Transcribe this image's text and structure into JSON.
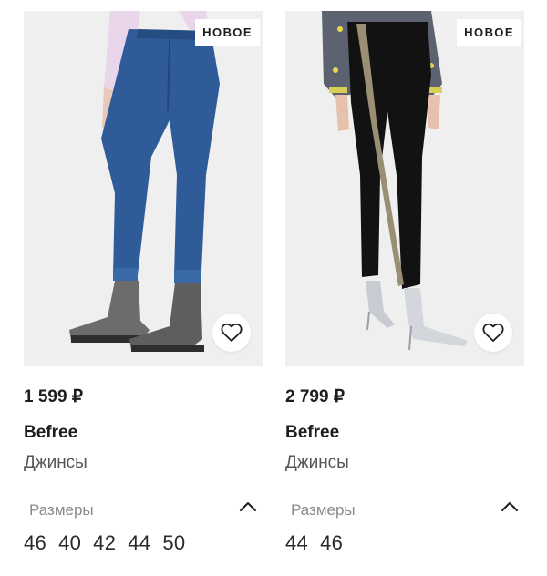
{
  "products": [
    {
      "badge": "НОВОЕ",
      "price": "1 599 ₽",
      "brand": "Befree",
      "name": "Джинсы",
      "sizes_label": "Размеры",
      "sizes": [
        "46",
        "40",
        "42",
        "44",
        "50"
      ],
      "icons": {
        "favorite": "heart-outline-icon",
        "collapse": "chevron-up-icon"
      }
    },
    {
      "badge": "НОВОЕ",
      "price": "2 799 ₽",
      "brand": "Befree",
      "name": "Джинсы",
      "sizes_label": "Размеры",
      "sizes": [
        "44",
        "46"
      ],
      "icons": {
        "favorite": "heart-outline-icon",
        "collapse": "chevron-up-icon"
      }
    }
  ],
  "colors": {
    "page_bg": "#ffffff",
    "photo_bg": "#efefef",
    "text": "#1d1d1d",
    "muted": "#8a8a8a"
  }
}
